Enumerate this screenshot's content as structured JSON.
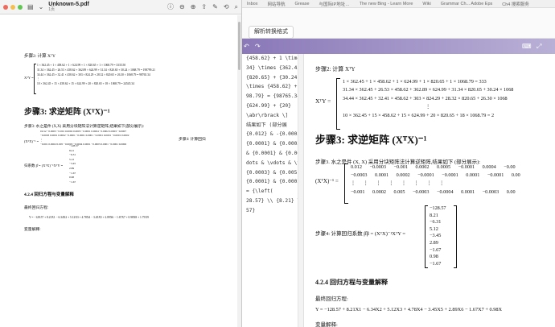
{
  "pdf": {
    "filename": "Unknown-5.pdf",
    "page_label": "1页",
    "step2_label": "步骤2: 计算 XᵀY",
    "eq1_lhs": "XᵀY =",
    "eq1_rows": [
      "1 × 362.45 + 1 × 458.62 + 1 × 624.99 + 1 × 820.65 + 1 × 1068.79 = 3335.50",
      "31.34 × 362.45 + 26.53 × 458.62 + 362.89 × 624.99 + 31.34 × 820.65 + 30.24 × 1068.79 = 198799.21",
      "34.44 × 362.45 + 32.41 × 458.62 + 303 × 824.29 + 28.32 × 820.65 + 26.30 × 1068.79 = 98765.34",
      "⋮",
      "10 × 362.45 + 15 × 458.62 + 15 × 624.99 + 20 × 820.65 + 18 × 1068.79 = 24545.34"
    ],
    "step3_heading": "步骤3: 求逆矩阵 (XᵀX)⁻¹",
    "step3_label": "步骤3: 水之是件 (X,X) 采用分块矩阵法计算逆矩阵,结果如下(部分展示):",
    "mat_lhs": "(XᵀX)⁻¹ =",
    "mat_rows": [
      "0.012  −0.0003  −0.001  0.0002  0.0005  −0.0001  0.0004  −0.0002  0.0003  −0.0007",
      "−0.0003  0.0001  0.0002  −0.0001  −0.0001  0.0001  −0.0001  0.0001  −0.0001  0.0002",
      "⋮",
      "−0.001  0.0002  0.005  −0.0003  −0.0004  0.0001  −0.0003  0.0001  −0.0001  0.0006"
    ],
    "step4_label": "步骤4: 计算回归",
    "vec_label": "归系数 β̂ = (XᵀX)⁻¹XᵀY =",
    "vec_values": [
      "−128.57",
      "8.21",
      "−6.31",
      "5.12",
      "−3.45",
      "2.89",
      "−1.67",
      "0.98",
      "−1.67"
    ],
    "section_heading": "4.2.4 回归方程与变量解释",
    "fit_label": "最终回归方程:",
    "fit_equation": "Y = −128.57 + 8.21X1 − 6.34X2 + 5.12X3 + 4.78X4 − 3.45X5 + 2.89X6 − 1.67X7 + 0.98X8 + 1.75X9",
    "var_label": "变量解释:"
  },
  "browser": {
    "bookmarks": [
      "Inbox",
      "网站导航",
      "Grease",
      "与国际IP地址…",
      "The new Bing - Learn More",
      "Wiki",
      "Grammar Ch... Adobe Eps",
      "Ch4 搜索服务"
    ],
    "convert_button": "解析转换格式",
    "editor_lines": [
      "",
      "",
      "{458.62} + 1 \\times",
      "34} \\times {362.45} +",
      "{820.65} + {30.24}",
      "\\times {458.62} +",
      "98.79} = {98765.34} \\\\",
      "{624.99} + {20}",
      "\\abr\\rbrack \\]",
      "",
      "",
      "结果如下 (部分展",
      "{0.012} & -{0.0003}",
      "{0.0001} & {0.0003} &",
      "& {0.0001} & {0.0000} &",
      "dots & \\vdots & \\vdots",
      "{0.0003} & {0.005} &",
      "{0.0001} & {0.0002}",
      "= {\\left(",
      "28.57} \\\\ {8.21} \\\\",
      "57}"
    ],
    "preview": {
      "step2_label": "步骤2: 计算 XᵀY",
      "eq1_lhs": "XᵀY =",
      "eq1_rows": [
        "1 × 362.45 + 1 × 458.62 + 1 × 624.99 + 1 × 820.65 + 1 × 1068.79 = 333",
        "31.34 × 362.45 + 26.53 × 458.62 + 362.89 × 624.99 + 31.34 × 820.65 + 30.24 × 1068",
        "34.44 × 362.45 + 32.41 × 458.62 + 303 × 824.29 + 28.32 × 820.65 + 26.30 × 1068",
        "⋮",
        "10 × 362.45 + 15 × 458.62 + 15 × 624.99 + 20 × 820.65 + 18 × 1068.79 = 2"
      ],
      "step3_heading": "步骤3: 求逆矩阵 (XᵀX)⁻¹",
      "step3_label": "步骤3. 水之是件 (X, X) 采用分块矩阵法计算逆矩阵,结果如下 (部分展示):",
      "mat_lhs": "(XᵀX)⁻¹ =",
      "mat_rows": [
        "0.012  −0.0003  −0.001  0.0002  0.0005  −0.0001  0.0004  −0.00",
        "−0.0003  0.0001  0.0002  −0.0001  −0.0001  0.0001  −0.0001  0.00",
        "⋮  ⋮  ⋮  ⋮  ⋮  ⋮  ⋮  ⋮",
        "−0.001  0.0002  0.005  −0.0003  −0.0004  0.0001  −0.0003  0.00"
      ],
      "step4_label": "步骤4: 计算回归系数 β̂β = (XᵀX)⁻¹XᵀY =",
      "vec_values": [
        "−128.57",
        "8.21",
        "−6.31",
        "5.12",
        "−3.45",
        "2.89",
        "−1.67",
        "0.98",
        "−1.67"
      ],
      "section_heading": "4.2.4 回归方程与变量解释",
      "fit_label": "最终回归方程:",
      "fit_equation": "Y = −128.57 + 8.21X1 − 6.34X2 + 5.12X3 + 4.78X4 − 3.45X5 + 2.89X6 − 1.67X7 + 0.98X",
      "var_label": "变量解释:"
    }
  }
}
